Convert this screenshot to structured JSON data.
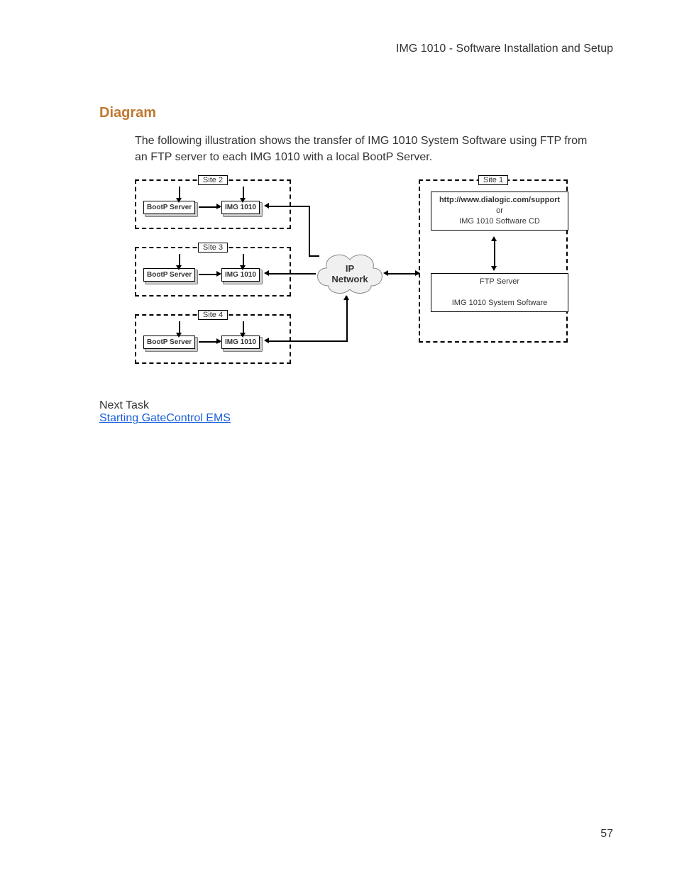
{
  "header": {
    "running_head": "IMG 1010 - Software Installation and Setup"
  },
  "section": {
    "title": "Diagram"
  },
  "body": {
    "paragraph": "The following illustration shows the transfer of IMG 1010 System Software using FTP from an FTP server to each IMG 1010 with a local BootP Server."
  },
  "diagram": {
    "sites_left": [
      {
        "label": "Site 2",
        "bootp": "BootP Server",
        "img": "IMG 1010"
      },
      {
        "label": "Site 3",
        "bootp": "BootP Server",
        "img": "IMG 1010"
      },
      {
        "label": "Site 4",
        "bootp": "BootP Server",
        "img": "IMG 1010"
      }
    ],
    "cloud": {
      "line1": "IP",
      "line2": "Network"
    },
    "site_right": {
      "label": "Site 1",
      "source_line1": "http://www.dialogic.com/support",
      "source_line2": "or",
      "source_line3": "IMG 1010 Software CD",
      "ftp_line1": "FTP Server",
      "ftp_line2": "IMG 1010 System Software"
    }
  },
  "footer": {
    "next_task_label": "Next Task",
    "next_task_link": "Starting GateControl EMS",
    "page_number": "57"
  }
}
